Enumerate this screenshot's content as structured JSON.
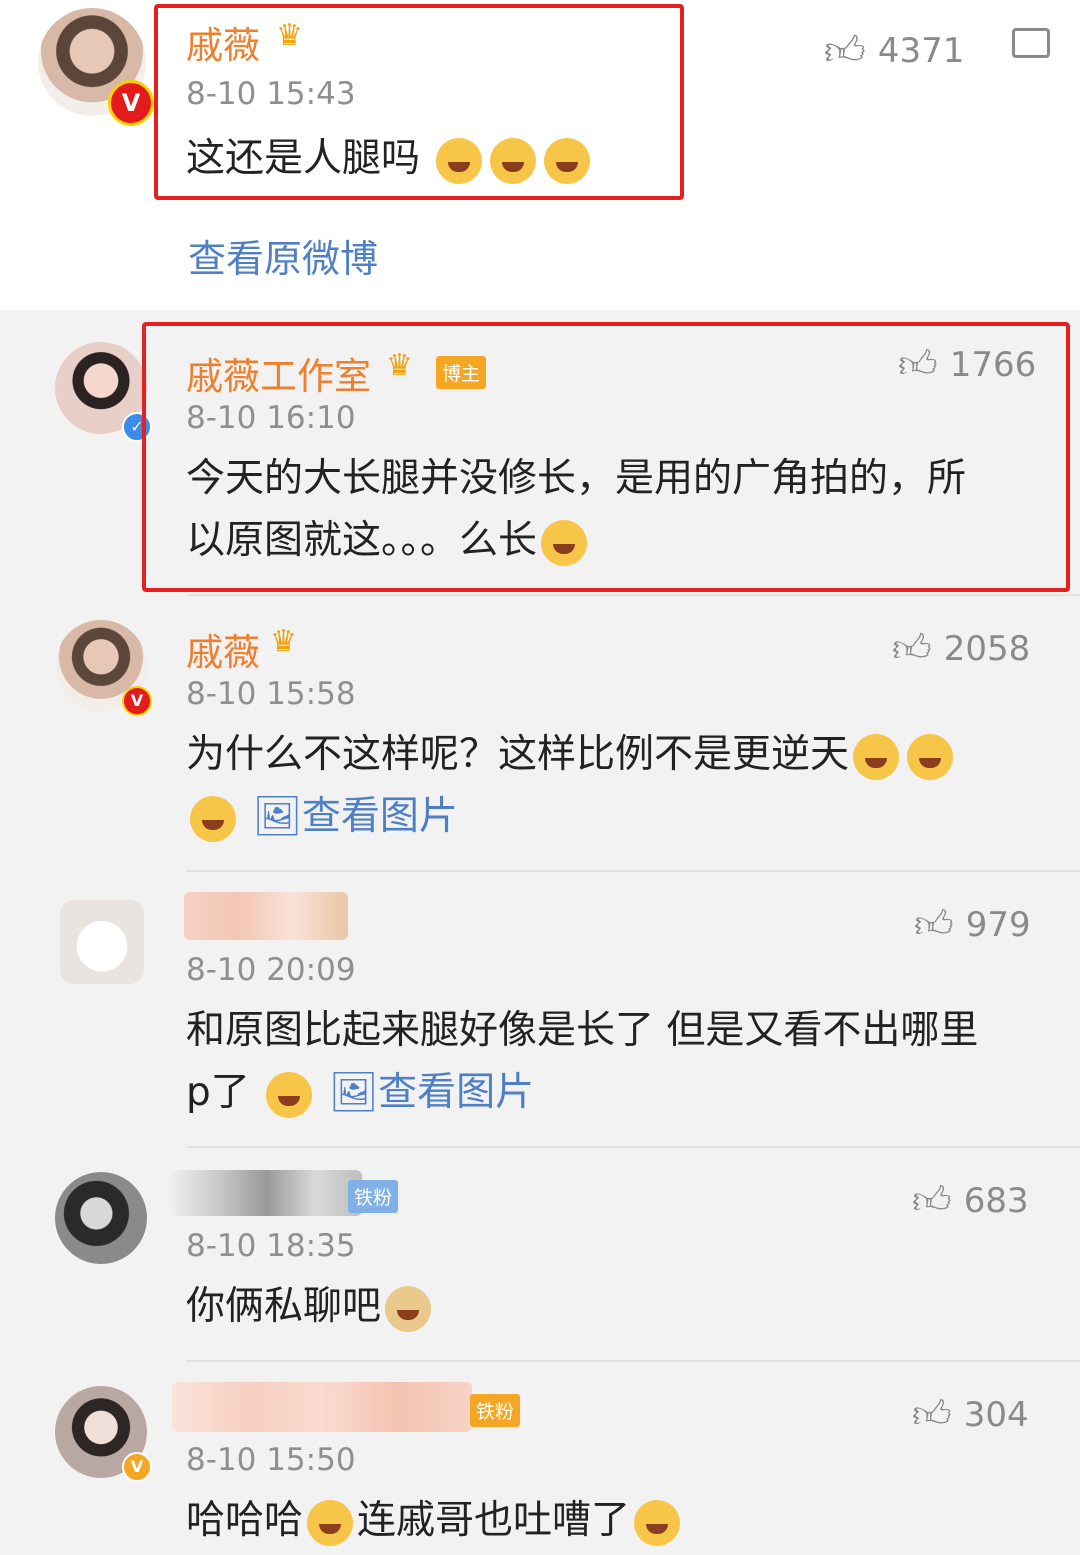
{
  "comments": [
    {
      "name": "戚薇",
      "time": "8-10 15:43",
      "text": "这还是人腿吗",
      "likes": "4371"
    },
    {
      "name": "戚薇工作室",
      "tag": "博主",
      "time": "8-10 16:10",
      "line1": "今天的大长腿并没修长，是用的广角拍的，所",
      "line2": "以原图就这。。。么长",
      "likes": "1766"
    },
    {
      "name": "戚薇",
      "time": "8-10 15:58",
      "line1": "为什么不这样呢？这样比例不是更逆天",
      "line2": "查看图片",
      "likes": "2058"
    },
    {
      "time": "8-10 20:09",
      "line1": "和原图比起来腿好像是长了 但是又看不出哪里",
      "line2_prefix": "p了",
      "line2_link": "查看图片",
      "likes": "979"
    },
    {
      "tag": "铁粉",
      "time": "8-10 18:35",
      "text": "你俩私聊吧",
      "likes": "683"
    },
    {
      "tag": "铁粉",
      "time": "8-10 15:50",
      "text_a": "哈哈哈",
      "text_b": "连戚哥也吐嘈了",
      "likes": "304"
    }
  ],
  "view_original": "查看原微博",
  "icons": [
    "thumb-up-icon",
    "comment-icon",
    "crown-icon",
    "image-icon",
    "verified-icon"
  ]
}
